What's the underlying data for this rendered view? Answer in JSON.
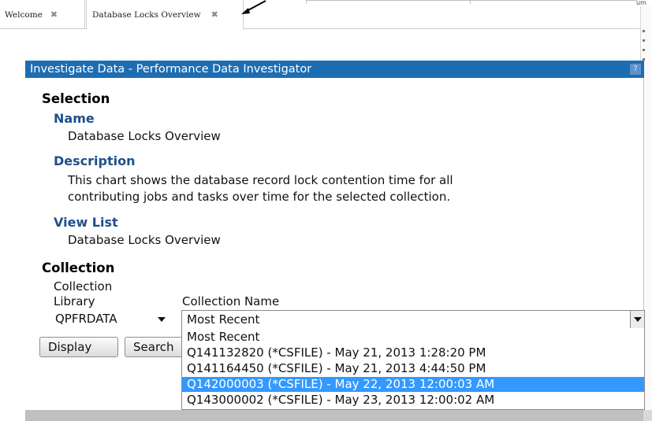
{
  "tabs": [
    {
      "label": "Welcome",
      "active": false
    },
    {
      "label": "Database Locks Overview",
      "active": true
    }
  ],
  "tab_close_glyph": "✖",
  "dialog": {
    "title": "Investigate Data - Performance Data Investigator",
    "help_glyph": "?"
  },
  "selection": {
    "heading": "Selection",
    "name_label": "Name",
    "name_value": "Database Locks Overview",
    "description_label": "Description",
    "description_line1": "This chart shows the database record lock contention time for all",
    "description_line2": "contributing jobs and tasks over time for the selected collection.",
    "view_list_label": "View List",
    "view_list_value": "Database Locks Overview"
  },
  "collection": {
    "heading": "Collection",
    "library_label_line1": "Collection",
    "library_label_line2": "Library",
    "library_value": "QPFRDATA",
    "name_label": "Collection Name",
    "name_value": "Most Recent",
    "options": [
      {
        "label": "Most Recent",
        "selected": false
      },
      {
        "label": "Q141132820 (*CSFILE) - May 21, 2013 1:28:20 PM",
        "selected": false
      },
      {
        "label": "Q141164450 (*CSFILE) - May 21, 2013 4:44:50 PM",
        "selected": false
      },
      {
        "label": "Q142000003 (*CSFILE) - May 22, 2013 12:00:03 AM",
        "selected": true
      },
      {
        "label": "Q143000002 (*CSFILE) - May 23, 2013 12:00:02 AM",
        "selected": false
      }
    ]
  },
  "buttons": {
    "display": "Display",
    "search": "Search"
  },
  "colors": {
    "title_bar": "#1d6db2",
    "section_label": "#1f4f8c",
    "selected_option": "#3399ff"
  },
  "icons": {
    "tab_close": "close-icon",
    "annotation_arrow": "arrow-icon",
    "dropdown": "chevron-down-icon",
    "help": "help-icon"
  }
}
